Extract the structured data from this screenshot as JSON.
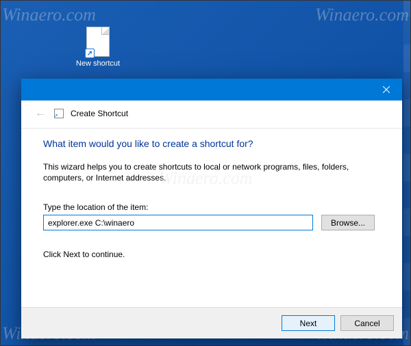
{
  "watermark": "Winaero.com",
  "desktop": {
    "shortcut_label": "New shortcut"
  },
  "wizard": {
    "window_title": "Create Shortcut",
    "heading": "What item would you like to create a shortcut for?",
    "description": "This wizard helps you to create shortcuts to local or network programs, files, folders, computers, or Internet addresses.",
    "location_label": "Type the location of the item:",
    "location_value": "explorer.exe C:\\winaero",
    "browse_label": "Browse...",
    "continue_hint": "Click Next to continue.",
    "next_label": "Next",
    "cancel_label": "Cancel"
  }
}
